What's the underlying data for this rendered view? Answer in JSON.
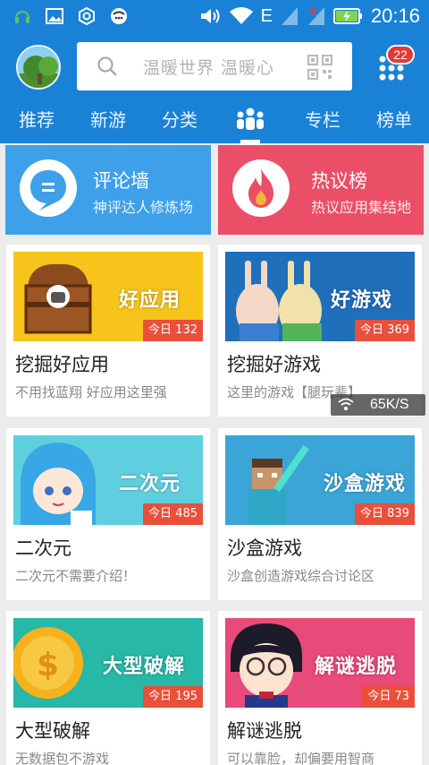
{
  "status_bar": {
    "time": "20:16",
    "network_label": "E",
    "icons": [
      "headset-icon",
      "image-icon",
      "settings-icon",
      "chat-app-icon",
      "volume-icon",
      "wifi-icon",
      "signal-icon",
      "battery-charging-icon"
    ]
  },
  "header": {
    "search_placeholder": "温暖世界 温暖心",
    "notification_count": "22"
  },
  "tabs": [
    {
      "label": "推荐"
    },
    {
      "label": "新游"
    },
    {
      "label": "分类"
    },
    {
      "label": "",
      "icon": "community-icon",
      "active": true
    },
    {
      "label": "专栏"
    },
    {
      "label": "榜单"
    }
  ],
  "features": [
    {
      "title": "评论墙",
      "subtitle": "神评达人修炼场",
      "color": "#3ea0e8",
      "icon": "comment-bubble-icon"
    },
    {
      "title": "热议榜",
      "subtitle": "热议应用集结地",
      "color": "#ea4f67",
      "icon": "flame-icon"
    }
  ],
  "cards": [
    {
      "title": "挖掘好应用",
      "desc": "不用找蓝翔 好应用这里强",
      "today": "今日 132",
      "image_text": "好应用",
      "image_bg": "#f6c41b"
    },
    {
      "title": "挖掘好游戏",
      "desc": "这里的游戏【腿玩辈】",
      "today": "今日 369",
      "image_text": "好游戏",
      "image_bg": "#1f6fba"
    },
    {
      "title": "二次元",
      "desc": "二次元不需要介绍！",
      "today": "今日 485",
      "image_text": "二次元",
      "image_bg": "#5fcfe0"
    },
    {
      "title": "沙盒游戏",
      "desc": "沙盒创造游戏综合讨论区",
      "today": "今日 839",
      "image_text": "沙盒游戏",
      "image_bg": "#3aa5d6"
    },
    {
      "title": "大型破解",
      "desc": "无数据包不游戏",
      "today": "今日 195",
      "image_text": "大型破解",
      "image_bg": "#27b8a8"
    },
    {
      "title": "解谜逃脱",
      "desc": "可以靠脸，却偏要用智商",
      "today": "今日 73",
      "image_text": "解谜逃脱",
      "image_bg": "#e84a7a"
    }
  ],
  "net_speed": "65K/S"
}
